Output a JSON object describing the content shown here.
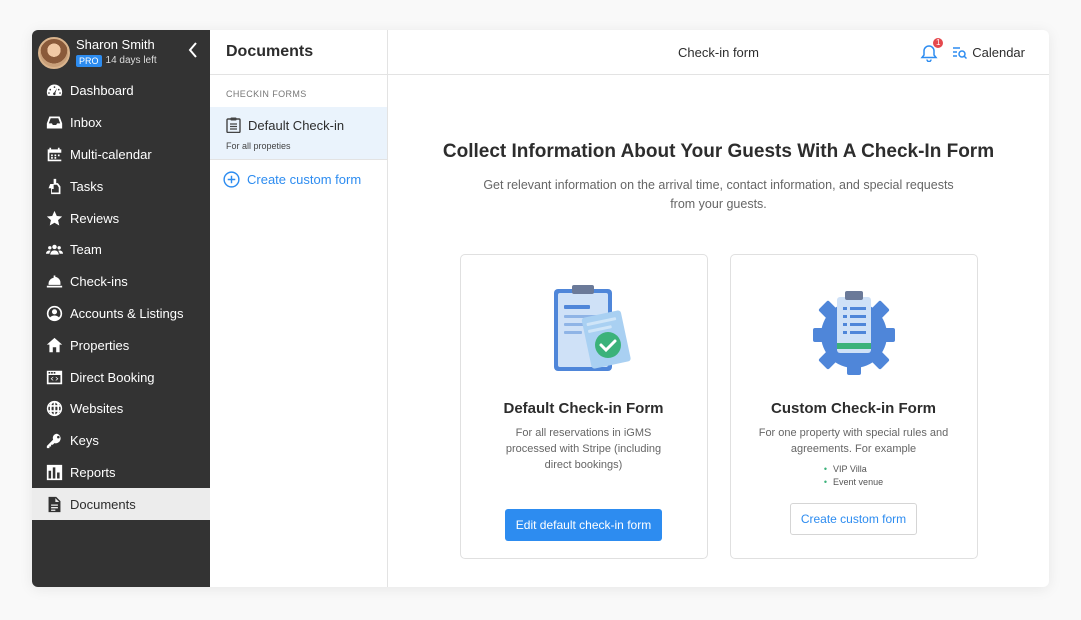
{
  "user": {
    "name": "Sharon Smith",
    "plan_badge": "PRO",
    "trial_status": "14 days left"
  },
  "sidebar": {
    "collapse_icon": "chevron-left-icon",
    "items": [
      {
        "label": "Dashboard",
        "icon": "dashboard-icon",
        "active": false
      },
      {
        "label": "Inbox",
        "icon": "inbox-icon",
        "active": false
      },
      {
        "label": "Multi-calendar",
        "icon": "calendar-icon",
        "active": false
      },
      {
        "label": "Tasks",
        "icon": "tasks-icon",
        "active": false
      },
      {
        "label": "Reviews",
        "icon": "star-icon",
        "active": false
      },
      {
        "label": "Team",
        "icon": "team-icon",
        "active": false
      },
      {
        "label": "Check-ins",
        "icon": "bell-service-icon",
        "active": false
      },
      {
        "label": "Accounts & Listings",
        "icon": "account-icon",
        "active": false
      },
      {
        "label": "Properties",
        "icon": "home-icon",
        "active": false
      },
      {
        "label": "Direct Booking",
        "icon": "code-window-icon",
        "active": false
      },
      {
        "label": "Websites",
        "icon": "globe-icon",
        "active": false
      },
      {
        "label": "Keys",
        "icon": "key-icon",
        "active": false
      },
      {
        "label": "Reports",
        "icon": "reports-icon",
        "active": false
      },
      {
        "label": "Documents",
        "icon": "document-icon",
        "active": true
      }
    ]
  },
  "documents_panel": {
    "title": "Documents",
    "section_label": "CHECKIN FORMS",
    "selected_item": {
      "title": "Default Check-in",
      "subtitle": "For all propeties"
    },
    "create_label": "Create custom form"
  },
  "topbar": {
    "title": "Check-in form",
    "notification_count": "1",
    "calendar_label": "Calendar"
  },
  "main": {
    "headline": "Collect Information About Your Guests With A Check-In Form",
    "subline": "Get relevant information on the arrival time, contact information, and special requests from your guests.",
    "cards": [
      {
        "title": "Default Check-in Form",
        "description": "For all reservations in iGMS processed with Stripe (including direct bookings)",
        "button_label": "Edit default check-in form"
      },
      {
        "title": "Custom Check-in Form",
        "description": "For one property with special rules and agreements. For example",
        "bullets": [
          "VIP Villa",
          "Event venue"
        ],
        "button_label": "Create custom form"
      }
    ]
  },
  "colors": {
    "sidebar_bg": "#333333",
    "accent": "#2d8cf0",
    "selected_bg": "#eaf3fc",
    "badge_red": "#e5484d",
    "bullet_green": "#3bb27a"
  }
}
